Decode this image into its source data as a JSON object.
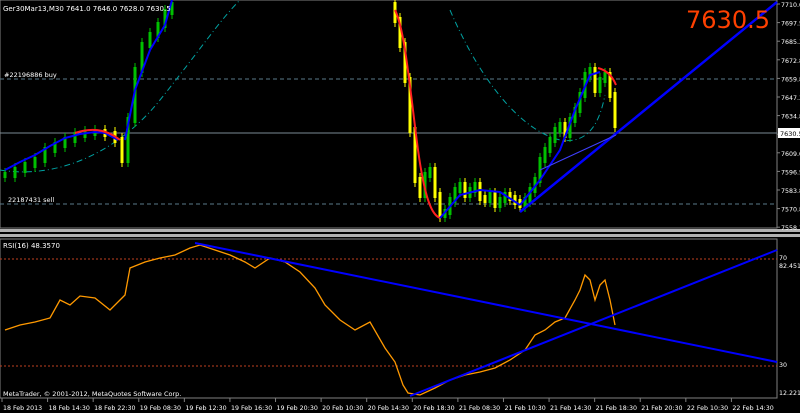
{
  "main_chart": {
    "header": "Ger30Mar13,M30  7641.0 7646.0 7628.0 7630.5",
    "big_price": "7630.5",
    "current_price_tag": "7630.5",
    "buy_label": "#22196886 buy",
    "sell_label": "22187431 sell",
    "price_ticks": [
      "7710.0",
      "7697.5",
      "7685.3",
      "7672.8",
      "7659.8",
      "7647.3",
      "7634.8",
      "7621.5",
      "7609.0",
      "7596.5",
      "7583.8",
      "7570.8",
      "7558.3"
    ],
    "colors": {
      "bull": "#00c000",
      "bear": "#ffff00",
      "ma": "#0000ff",
      "ma_down": "#ff2020",
      "trend": "#0000ff",
      "envelope": "#00a0a0",
      "big_price": "#ff4000"
    }
  },
  "rsi_panel": {
    "header": "RSI(16) 48.3570",
    "ticks": [
      "82.4516",
      "70",
      "30",
      "12.2219"
    ],
    "color": "#ff9900"
  },
  "time_axis": [
    "18 Feb 2013",
    "18 Feb 14:30",
    "18 Feb 22:30",
    "19 Feb 08:30",
    "19 Feb 12:30",
    "19 Feb 16:30",
    "19 Feb 20:30",
    "20 Feb 10:30",
    "20 Feb 14:30",
    "20 Feb 18:30",
    "21 Feb 08:30",
    "21 Feb 10:30",
    "21 Feb 14:30",
    "21 Feb 18:30",
    "21 Feb 20:30",
    "22 Feb 10:30",
    "22 Feb 14:30"
  ],
  "copyright": "MetaTrader, © 2001-2012, MetaQuotes Software Corp."
}
